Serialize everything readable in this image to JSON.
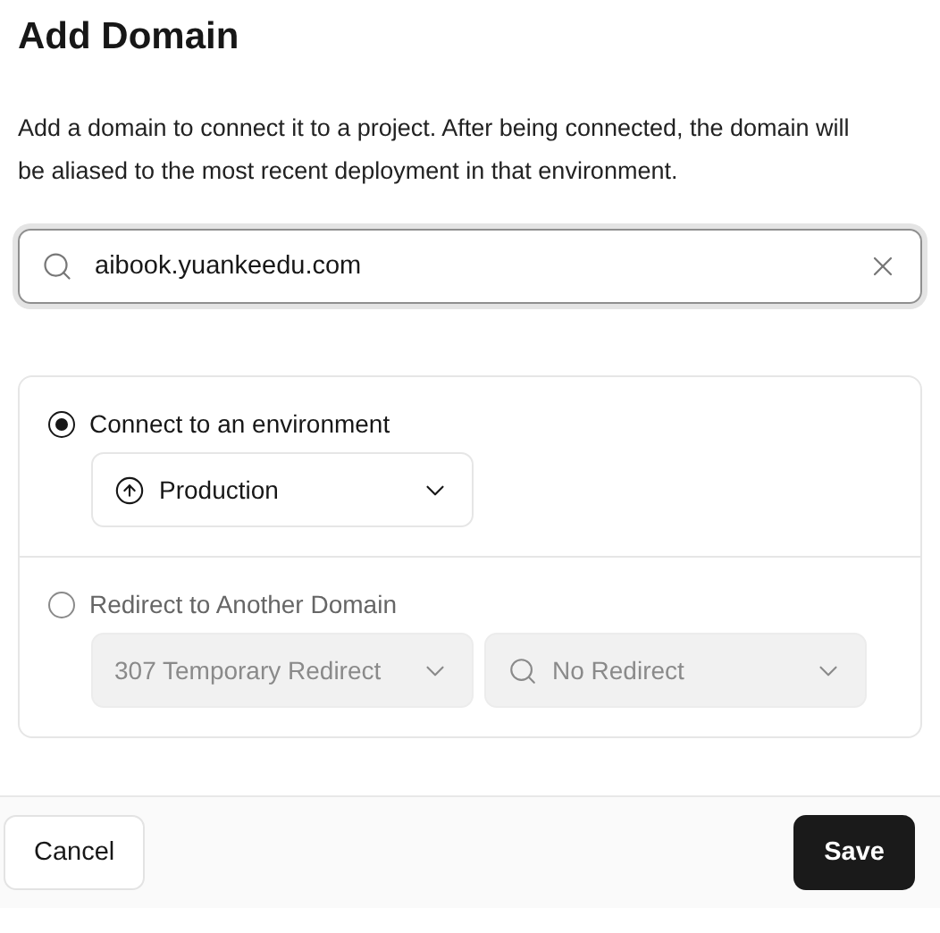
{
  "dialog": {
    "title": "Add Domain",
    "description": "Add a domain to connect it to a project. After being connected, the domain will be aliased to the most recent deployment in that environment."
  },
  "domain_field": {
    "value": "aibook.yuankeedu.com"
  },
  "options": [
    {
      "label": "Connect to an environment",
      "selected": true,
      "disabled": false,
      "selects": [
        {
          "kind": "environment",
          "value": "Production"
        }
      ]
    },
    {
      "label": "Redirect to Another Domain",
      "selected": false,
      "disabled": true,
      "selects": [
        {
          "kind": "plain",
          "value": "307 Temporary Redirect"
        },
        {
          "kind": "search",
          "value": "No Redirect"
        }
      ]
    }
  ],
  "footer": {
    "buttons": [
      {
        "label": "Cancel",
        "kind": "secondary"
      },
      {
        "label": "Save",
        "kind": "primary"
      }
    ]
  }
}
